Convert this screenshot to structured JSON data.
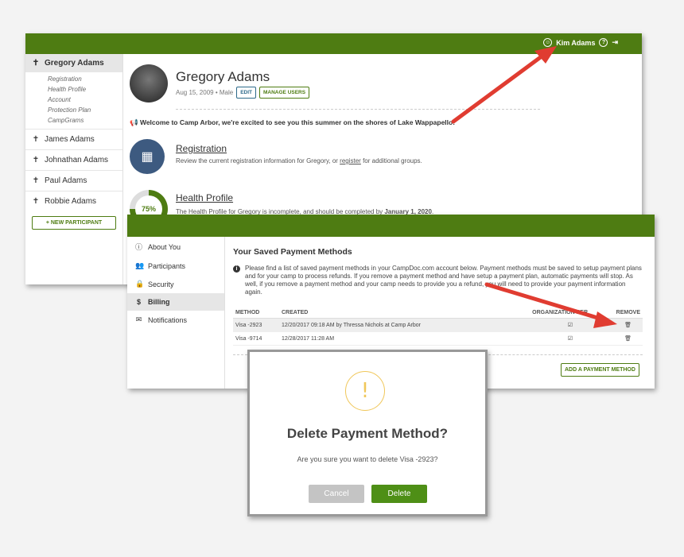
{
  "colors": {
    "brand": "#4e7c12",
    "arrow": "#e03c31",
    "warning": "#f0c75a"
  },
  "header": {
    "user_name": "Kim Adams",
    "user_icon": "user-circle-icon",
    "help_icon": "question-icon",
    "logout_icon": "logout-icon"
  },
  "participant_sidebar": {
    "active": "Gregory Adams",
    "sub_items": [
      "Registration",
      "Health Profile",
      "Account",
      "Protection Plan",
      "CampGrams"
    ],
    "others": [
      "James Adams",
      "Johnathan Adams",
      "Paul Adams",
      "Robbie Adams"
    ],
    "new_participant": "NEW PARTICIPANT"
  },
  "profile": {
    "name": "Gregory Adams",
    "meta": "Aug 15, 2009 • Male",
    "edit_label": "EDIT",
    "manage_label": "MANAGE USERS",
    "welcome": "Welcome to Camp Arbor, we're excited to see you this summer on the shores of Lake Wappapello!",
    "registration": {
      "title": "Registration",
      "text_pre": "Review the current registration information for Gregory, or ",
      "link": "register",
      "text_post": " for additional groups."
    },
    "health": {
      "title": "Health Profile",
      "percent": "75%",
      "progress": 0.75,
      "text_pre": "The Health Profile for Gregory is incomplete, and should be completed by ",
      "date": "January 1, 2020",
      "text_post": "."
    }
  },
  "account_sidebar": {
    "items": [
      {
        "label": "About You",
        "icon": "info-icon"
      },
      {
        "label": "Participants",
        "icon": "users-icon"
      },
      {
        "label": "Security",
        "icon": "lock-icon"
      },
      {
        "label": "Billing",
        "icon": "dollar-icon"
      },
      {
        "label": "Notifications",
        "icon": "envelope-icon"
      }
    ],
    "active": "Billing"
  },
  "billing": {
    "title": "Your Saved Payment Methods",
    "info_visible": "Please find a list of saved payment methods in your CampDoc.com account below. Payment methods must be saved to setup payment plans and for your camp to process refunds. If you remove a payment method and have setup a payment plan, automatic payments will stop. As well, if you remove a payment method and your camp needs to provide you a refund, you will need to provide your payment information again.",
    "columns": {
      "method": "METHOD",
      "created": "CREATED",
      "org": "ORGANIZATION PER",
      "remove": "REMOVE"
    },
    "rows": [
      {
        "method": "Visa -2923",
        "created": "12/20/2017 09:18 AM by Thressa Nichols at Camp Arbor"
      },
      {
        "method": "Visa -9714",
        "created": "12/28/2017 11:28 AM"
      }
    ],
    "add_label": "ADD A PAYMENT METHOD"
  },
  "modal": {
    "title": "Delete Payment Method?",
    "message": "Are you sure you want to delete Visa -2923?",
    "cancel": "Cancel",
    "delete": "Delete"
  }
}
